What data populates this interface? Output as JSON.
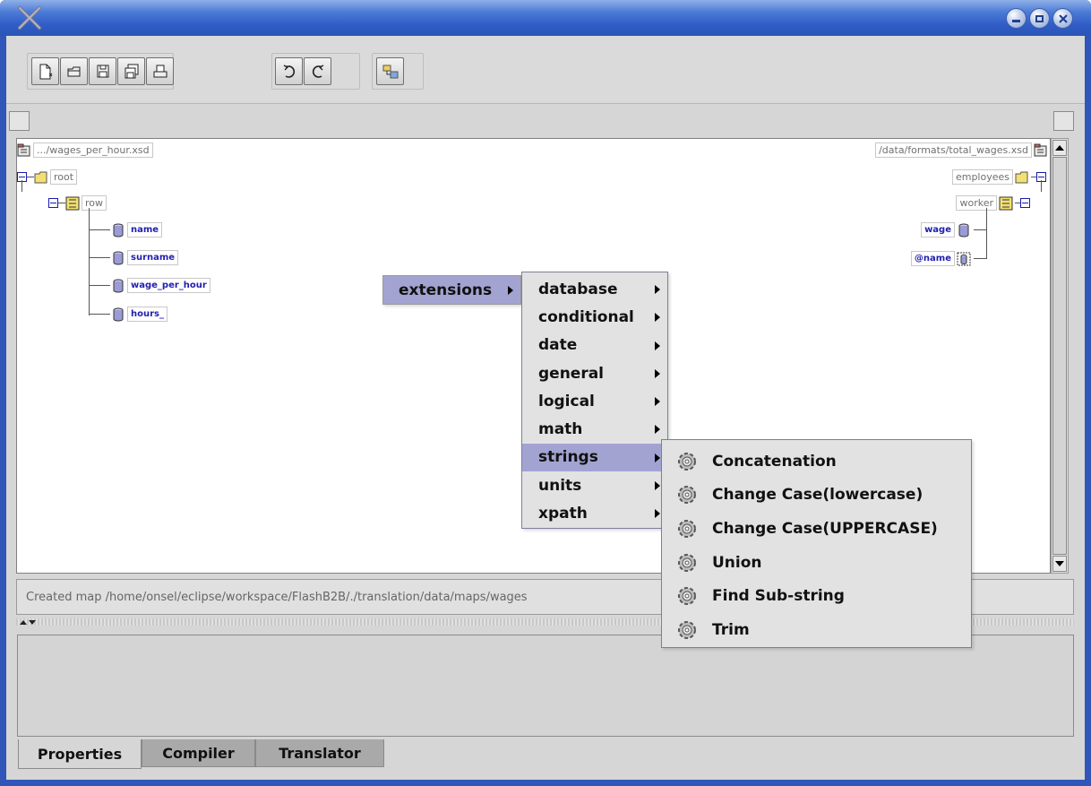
{
  "window": {
    "title": "",
    "buttons": [
      "minimize-icon",
      "maximize-icon",
      "close-icon"
    ]
  },
  "toolbar": {
    "buttons": [
      "new-document-icon",
      "open-folder-icon",
      "save-icon",
      "save-all-icon",
      "print-icon",
      "undo-icon",
      "redo-icon",
      "map-icon"
    ]
  },
  "source_tree": {
    "file": ".../wages_per_hour.xsd",
    "root": "root",
    "row": "row",
    "fields": [
      "name",
      "surname",
      "wage_per_hour",
      "hours_"
    ]
  },
  "target_tree": {
    "file": "/data/formats/total_wages.xsd",
    "root": "employees",
    "row": "worker",
    "fields": [
      "wage",
      "@name"
    ]
  },
  "menus": {
    "root_item": "extensions",
    "extensions": [
      "database",
      "conditional",
      "date",
      "general",
      "logical",
      "math",
      "strings",
      "units",
      "xpath"
    ],
    "selected": "strings",
    "strings": [
      "Concatenation",
      "Change Case(lowercase)",
      "Change Case(UPPERCASE)",
      "Union",
      "Find Sub-string",
      "Trim"
    ]
  },
  "status": {
    "text": "Created map /home/onsel/eclipse/workspace/FlashB2B/./translation/data/maps/wages"
  },
  "tabs": [
    "Properties",
    "Compiler",
    "Translator"
  ],
  "colors": {
    "titlebar": "#2f5cc6",
    "menu_highlight": "#a3a3d2",
    "tree_text": "#1f1fb0"
  }
}
